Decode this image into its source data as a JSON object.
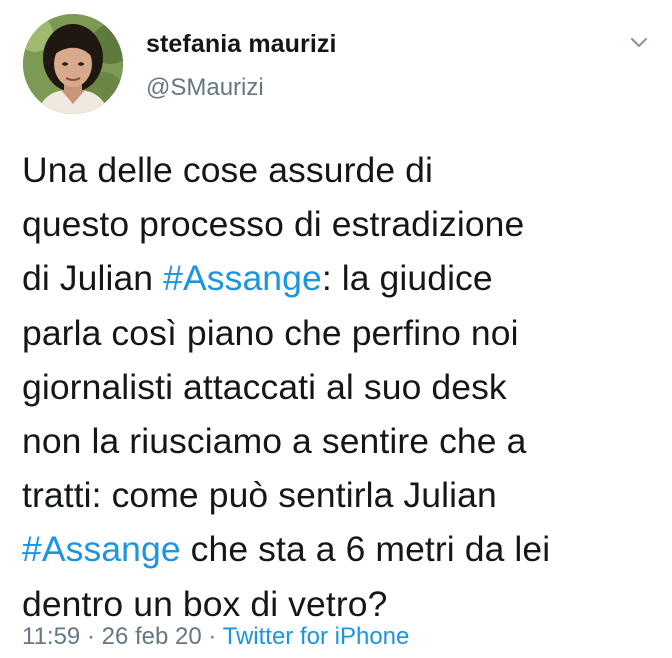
{
  "author": {
    "name": "stefania maurizi",
    "handle": "@SMaurizi"
  },
  "tweet": {
    "lines": [
      {
        "segments": [
          {
            "text": "Una delle cose assurde di"
          }
        ]
      },
      {
        "segments": [
          {
            "text": "questo processo di estradizione"
          }
        ]
      },
      {
        "segments": [
          {
            "text": "di Julian "
          },
          {
            "text": "#Assange",
            "hashtag": true
          },
          {
            "text": ": la giudice"
          }
        ]
      },
      {
        "segments": [
          {
            "text": "parla così piano che perfino noi"
          }
        ]
      },
      {
        "segments": [
          {
            "text": "giornalisti attaccati al suo desk"
          }
        ]
      },
      {
        "segments": [
          {
            "text": "non la riusciamo a sentire che a"
          }
        ]
      },
      {
        "segments": [
          {
            "text": "tratti: come può sentirla Julian"
          }
        ]
      },
      {
        "segments": [
          {
            "text": "#Assange",
            "hashtag": true
          },
          {
            "text": " che sta a 6 metri da lei"
          }
        ]
      },
      {
        "segments": [
          {
            "text": "dentro un box di vetro?"
          }
        ]
      }
    ]
  },
  "meta": {
    "time": "11:59",
    "separator1": " · ",
    "date": "26 feb 20",
    "separator2": " · ",
    "source": "Twitter for iPhone"
  },
  "icons": {
    "menu": "chevron-down-icon"
  },
  "colors": {
    "text": "#14171a",
    "secondary": "#657786",
    "link": "#1b95e0"
  }
}
